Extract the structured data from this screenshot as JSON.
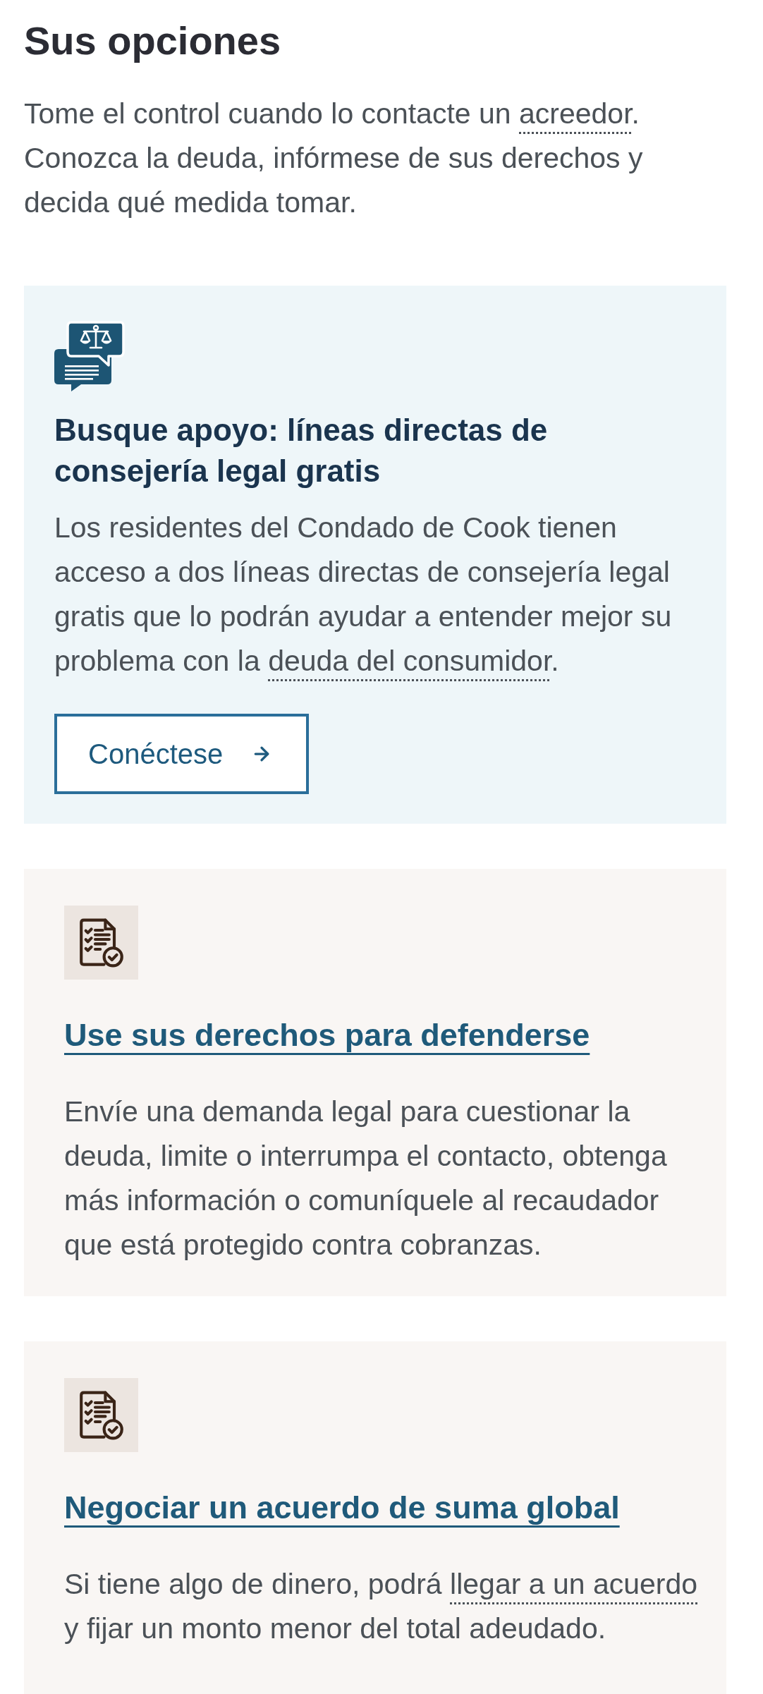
{
  "heading": "Sus opciones",
  "intro": [
    {
      "kind": "text",
      "text": "Tome el control cuando lo contacte un "
    },
    {
      "kind": "term",
      "text": "acreedor"
    },
    {
      "kind": "text",
      "text": ". Conozca la deuda, infórmese de sus derechos y decida qué medida tomar."
    }
  ],
  "cards": [
    {
      "kind": "featured",
      "title": "Busque apoyo: líneas directas de consejería legal gratis",
      "body": [
        {
          "kind": "text",
          "text": "Los residentes del Condado de Cook tienen acceso a dos líneas directas de consejería legal gratis que lo podrán ayudar a entender mejor su problema con la "
        },
        {
          "kind": "term",
          "text": "deuda del consumidor"
        },
        {
          "kind": "text",
          "text": "."
        }
      ],
      "button": "Conéctese"
    },
    {
      "kind": "option",
      "title": "Use sus derechos para defenderse",
      "body": [
        {
          "kind": "text",
          "text": "Envíe una demanda legal para cuestionar la deuda, limite o interrumpa el contacto, obtenga más información o comuníquele al recaudador que está protegido contra cobranzas."
        }
      ]
    },
    {
      "kind": "option",
      "title": "Negociar un acuerdo de suma global",
      "body": [
        {
          "kind": "text",
          "text": "Si tiene algo de dinero, podrá "
        },
        {
          "kind": "term",
          "text": "llegar a un acuerdo"
        },
        {
          "kind": "text",
          "text": " y fijar un monto menor del total adeudado."
        }
      ]
    }
  ]
}
